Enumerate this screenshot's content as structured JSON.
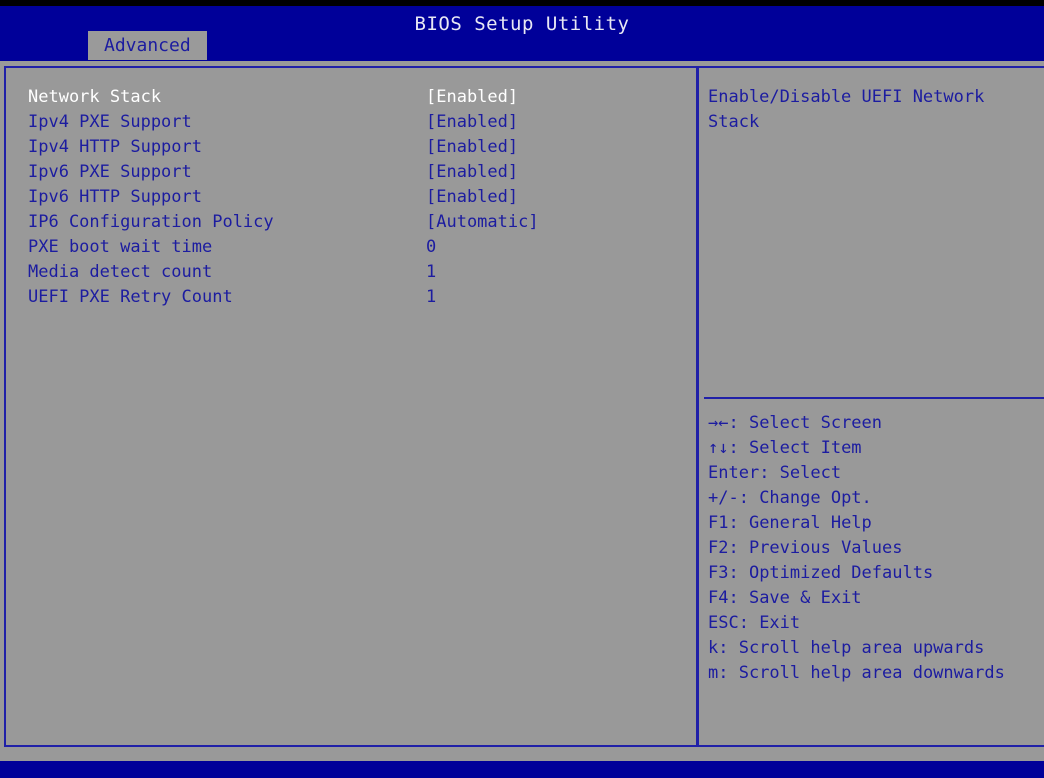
{
  "window": {
    "title": "BIOS Setup Utility"
  },
  "tabs": [
    {
      "label": "Advanced",
      "active": true
    }
  ],
  "settings": [
    {
      "label": "Network Stack",
      "value": "[Enabled]",
      "selected": true
    },
    {
      "label": "Ipv4 PXE Support",
      "value": "[Enabled]",
      "selected": false
    },
    {
      "label": "Ipv4 HTTP Support",
      "value": "[Enabled]",
      "selected": false
    },
    {
      "label": "Ipv6 PXE Support",
      "value": "[Enabled]",
      "selected": false
    },
    {
      "label": "Ipv6 HTTP Support",
      "value": "[Enabled]",
      "selected": false
    },
    {
      "label": "IP6 Configuration Policy",
      "value": "[Automatic]",
      "selected": false
    },
    {
      "label": "PXE boot wait time",
      "value": "0",
      "selected": false
    },
    {
      "label": "Media detect count",
      "value": "1",
      "selected": false
    },
    {
      "label": "UEFI PXE Retry Count",
      "value": "1",
      "selected": false
    }
  ],
  "help": {
    "text": "Enable/Disable UEFI Network Stack"
  },
  "legend": [
    {
      "keys": "→←",
      "action": ": Select Screen"
    },
    {
      "keys": "↑↓",
      "action": ": Select Item"
    },
    {
      "keys": "Enter",
      "action": ": Select"
    },
    {
      "keys": "+/-",
      "action": ": Change Opt."
    },
    {
      "keys": "F1",
      "action": ": General Help"
    },
    {
      "keys": "F2",
      "action": ": Previous Values"
    },
    {
      "keys": "F3",
      "action": ": Optimized Defaults"
    },
    {
      "keys": "F4",
      "action": ": Save & Exit"
    },
    {
      "keys": "ESC",
      "action": ": Exit"
    },
    {
      "keys": "k",
      "action": ": Scroll help area upwards"
    },
    {
      "keys": "m",
      "action": ": Scroll help area downwards"
    }
  ],
  "status_bar": {
    "text": ""
  },
  "colors": {
    "background_gray": "#999999",
    "header_blue": "#000099",
    "text_blue": "#1c1ca0",
    "border_blue": "#2020a8",
    "selected_text": "#ffffff",
    "title_text": "#e8e8f4"
  }
}
